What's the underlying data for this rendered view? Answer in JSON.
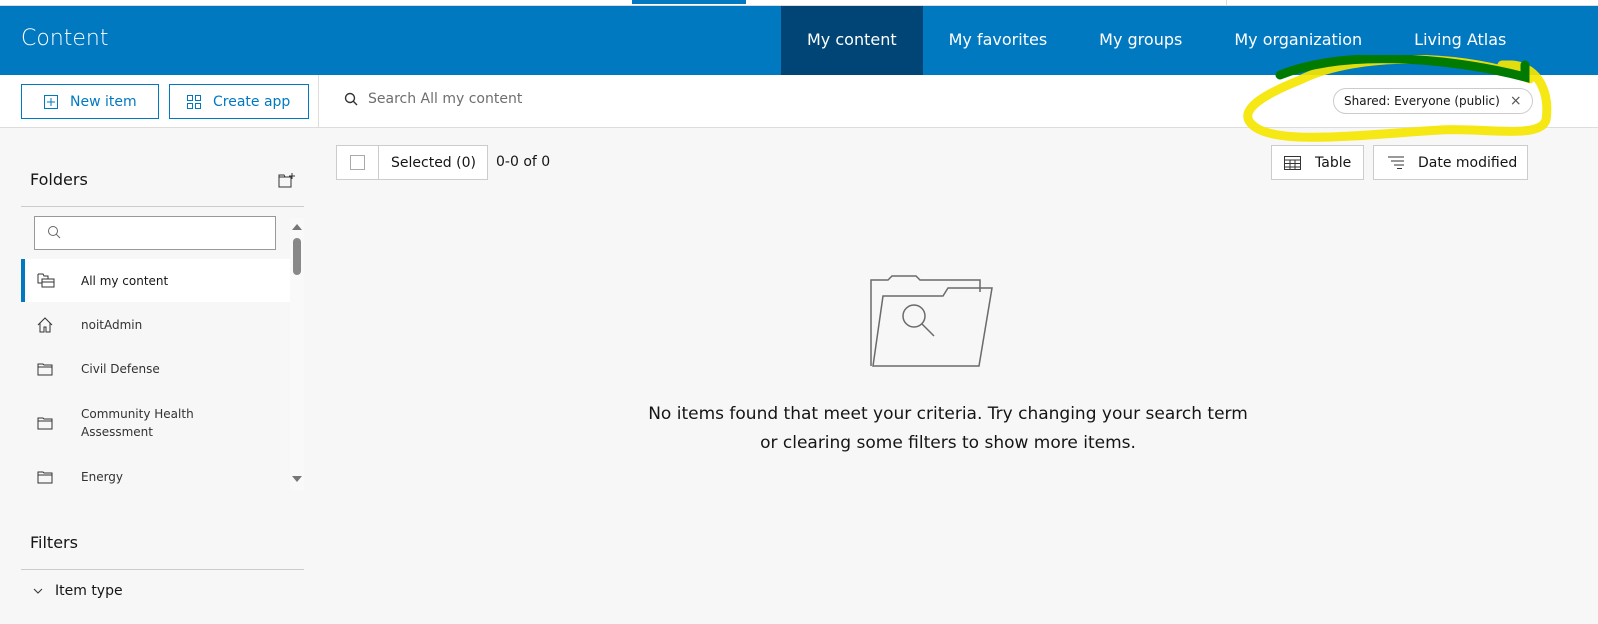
{
  "header": {
    "title": "Content",
    "nav": [
      "My content",
      "My favorites",
      "My groups",
      "My organization",
      "Living Atlas"
    ],
    "active": "My content"
  },
  "toolbar": {
    "new_item": "New item",
    "create_app": "Create app",
    "search_placeholder": "Search All my content",
    "filter_chip": "Shared: Everyone (public)",
    "chip_close": "×"
  },
  "sidebar": {
    "folders_title": "Folders",
    "folders": [
      "All my content",
      "noitAdmin",
      "Civil Defense",
      "Community Health Assessment",
      "Energy"
    ],
    "filters_title": "Filters",
    "filter_item": "Item type"
  },
  "main": {
    "selected": "Selected (0)",
    "count": "0-0 of 0",
    "view": "Table",
    "sort": "Date modified",
    "empty_line1": "No items found that meet your criteria. Try changing your search term",
    "empty_line2": "or clearing some filters to show more items."
  },
  "colors": {
    "brand": "#0079c1",
    "nav_active": "#004575",
    "highlight": "#f5e600"
  }
}
